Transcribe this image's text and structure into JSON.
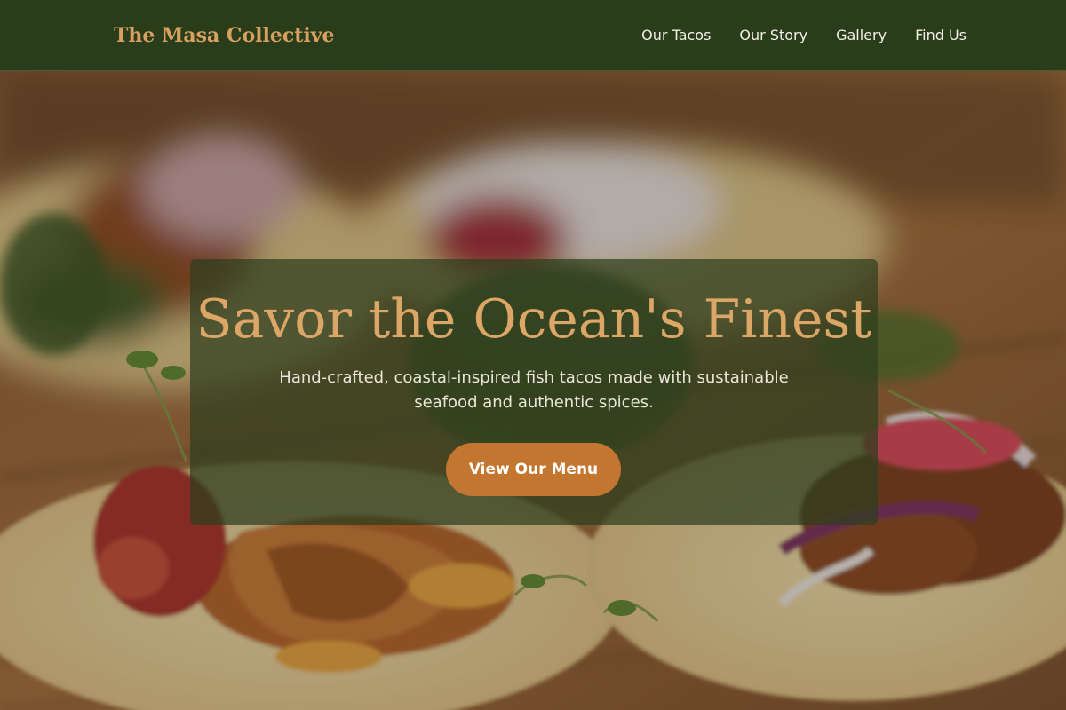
{
  "nav": {
    "brand": "The Masa Collective",
    "links": [
      {
        "label": "Our Tacos"
      },
      {
        "label": "Our Story"
      },
      {
        "label": "Gallery"
      },
      {
        "label": "Find Us"
      }
    ]
  },
  "hero": {
    "title": "Savor the Ocean's Finest",
    "subtitle": "Hand-crafted, coastal-inspired fish tacos made with sustainable seafood and authentic spices.",
    "cta_label": "View Our Menu",
    "background_image": "fish-tacos-photo"
  },
  "colors": {
    "nav_background": "#2a3d1b",
    "brand_text": "#d9a060",
    "hero_title": "#dca666",
    "cta_background": "#c37630",
    "card_overlay": "#2e3e1e"
  }
}
